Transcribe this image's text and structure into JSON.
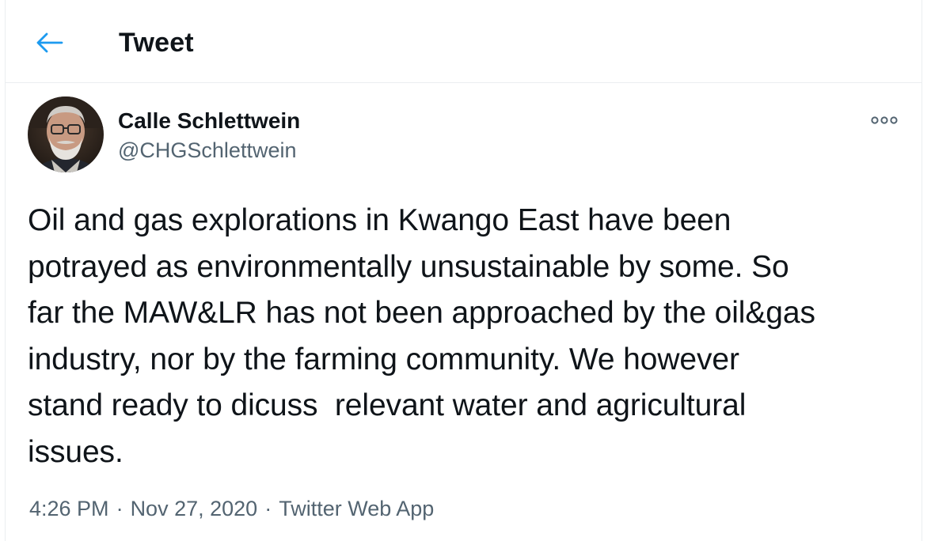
{
  "header": {
    "title": "Tweet",
    "back_icon": "arrow-left-icon",
    "accent_color": "#1d9bf0"
  },
  "author": {
    "display_name": "Calle Schlettwein",
    "handle": "@CHGSchlettwein",
    "avatar_icon": "user-avatar"
  },
  "tweet": {
    "text": "Oil and gas explorations in Kwango East have been\npotrayed as environmentally unsustainable by some. So\nfar the MAW&LR has not been approached by the oil&gas\nindustry, nor by the farming community. We however\nstand ready to dicuss  relevant water and agricultural\nissues.",
    "time": "4:26 PM",
    "date": "Nov 27, 2020",
    "source": "Twitter Web App",
    "separator": "·",
    "more_icon": "more-options-icon"
  }
}
